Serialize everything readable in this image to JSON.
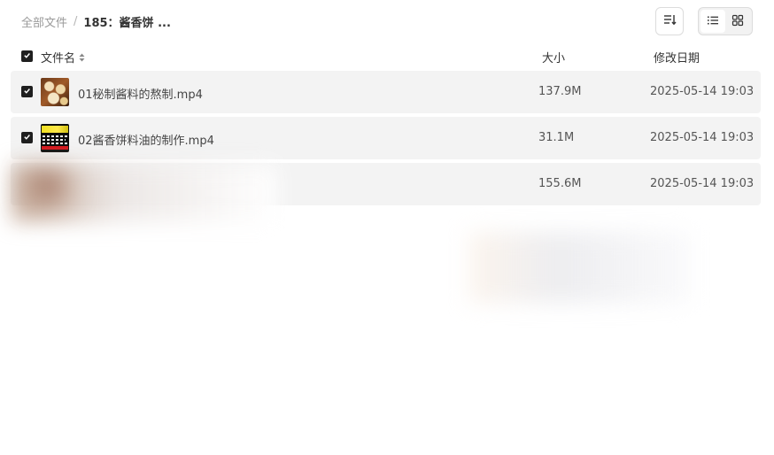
{
  "breadcrumb": {
    "root": "全部文件",
    "separator": "/",
    "current": "185：酱香饼 ..."
  },
  "toolbar": {
    "sort_icon": "sort-icon",
    "list_view_icon": "list-view-icon",
    "grid_view_icon": "grid-view-icon",
    "active_view": "list"
  },
  "table": {
    "headers": {
      "name": "文件名",
      "size": "大小",
      "date": "修改日期"
    },
    "select_all_checked": true,
    "rows": [
      {
        "checked": true,
        "name": "01秘制酱料的熬制.mp4",
        "size": "137.9M",
        "modified": "2025-05-14 19:03",
        "thumbnail": "video-thumbnail"
      },
      {
        "checked": true,
        "name": "02酱香饼料油的制作.mp4",
        "size": "31.1M",
        "modified": "2025-05-14 19:03",
        "thumbnail": "video-thumbnail"
      },
      {
        "checked": false,
        "name": "",
        "size": "155.6M",
        "modified": "2025-05-14 19:03",
        "thumbnail": ""
      }
    ]
  },
  "colors": {
    "checkbox": "#1f1f1f",
    "row_background": "#f3f3f3",
    "muted_text": "#9a9a9a"
  }
}
